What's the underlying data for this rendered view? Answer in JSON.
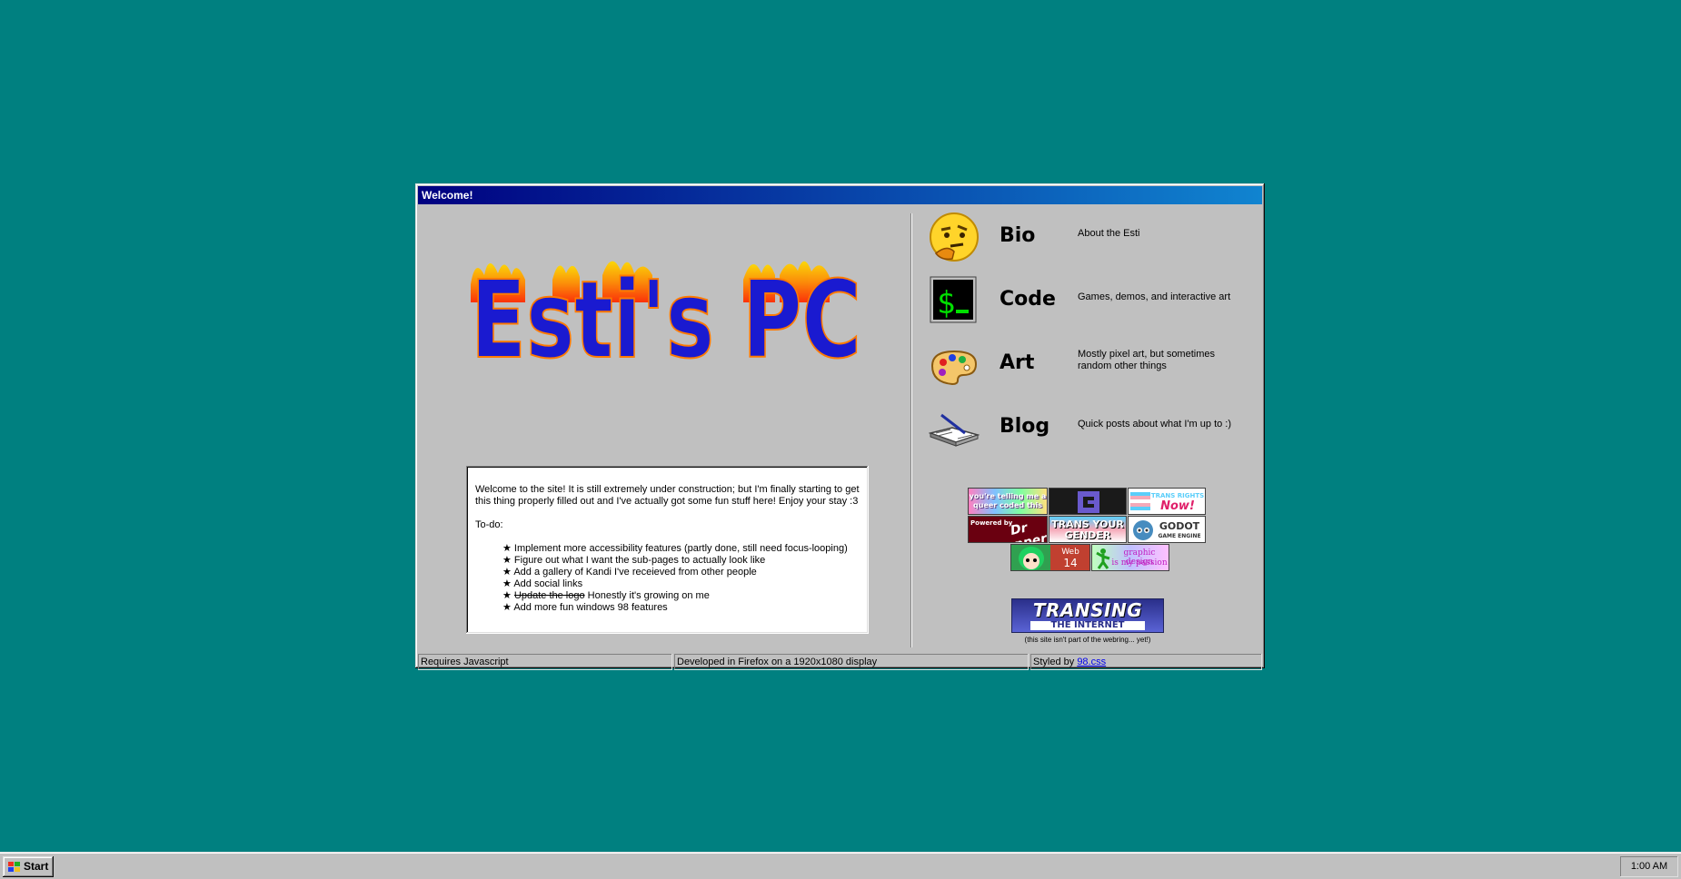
{
  "window": {
    "title": "Welcome!"
  },
  "logo": {
    "text": "Esti's PC",
    "colors": {
      "fill": "#1a1ad0",
      "flame": "#ff7a00"
    }
  },
  "welcome": {
    "intro": "Welcome to the site! It is still extremely under construction; but I'm finally starting to get this thing properly filled out and I've actually got some fun stuff here! Enjoy your stay :3",
    "todo_label": "To-do:",
    "todo": [
      "Implement more accessibility features (partly done, still need focus-looping)",
      "Figure out what I want the sub-pages to actually look like",
      "Add a gallery of Kandi I've receieved from other people",
      "Add social links"
    ],
    "todo_done": {
      "struck": "Update the logo",
      "rest": " Honestly it's growing on me"
    },
    "todo_last": "Add more fun windows 98 features"
  },
  "nav": [
    {
      "title": "Bio",
      "description": "About the Esti",
      "icon": "thinking-face-icon"
    },
    {
      "title": "Code",
      "description": "Games, demos, and interactive art",
      "icon": "terminal-icon"
    },
    {
      "title": "Art",
      "description": "Mostly pixel art, but sometimes random other things",
      "icon": "paint-palette-icon"
    },
    {
      "title": "Blog",
      "description": "Quick posts about what I'm up to :)",
      "icon": "open-book-icon"
    }
  ],
  "badges": {
    "queer_coded": "you're telling me a queer coded this",
    "trans_rights_top": "TRANS RIGHTS",
    "trans_rights_bottom": "Now!",
    "powered_by": "Powered by",
    "dr_pepper": "Dr Pepper",
    "trans_gender_top": "TRANS YOUR",
    "trans_gender_bottom": "GENDER",
    "godot_top": "GODOT",
    "godot_bottom": "GAME ENGINE",
    "web_top": "Web",
    "web_bottom": "14",
    "graphic_design_top": "graphic design",
    "graphic_design_bottom": "is my passion"
  },
  "webring": {
    "line1": "TRANSING",
    "line2": "THE INTERNET",
    "note": "(this site isn't part of the webring... yet!)"
  },
  "status": {
    "js": "Requires Javascript",
    "developed": "Developed in Firefox on a 1920x1080 display",
    "styled_prefix": "Styled by ",
    "styled_link": "98.css"
  },
  "taskbar": {
    "start": "Start",
    "clock": "1:00 AM"
  },
  "colors": {
    "desktop": "#008080",
    "titlebar_start": "#000080",
    "titlebar_end": "#1084d0",
    "face": "#c0c0c0"
  }
}
